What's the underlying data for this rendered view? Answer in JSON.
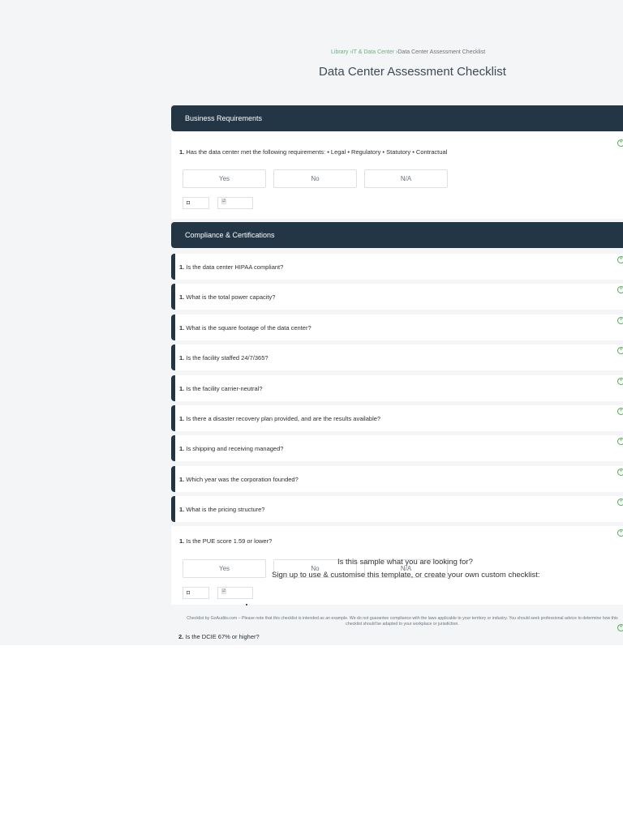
{
  "breadcrumb": {
    "library": "Library",
    "category": "›IT & Data Center",
    "current": "›Data Center Assessment Checklist"
  },
  "page_title": "Data Center Assessment Checklist",
  "sections": [
    {
      "title": "Business Requirements",
      "question": {
        "number": "1.",
        "text": "Has the data center met the following requirements: • Legal • Regulatory • Statutory • Contractual",
        "answers": [
          "Yes",
          "No",
          "N/A"
        ]
      }
    },
    {
      "title": "Compliance & Certifications",
      "questions": [
        {
          "number": "1.",
          "text": "Is the data center HIPAA compliant?"
        },
        {
          "number": "1.",
          "text": "What is the total power capacity?"
        },
        {
          "number": "1.",
          "text": "What is the square footage of the data center?"
        },
        {
          "number": "1.",
          "text": "Is the facility staffed 24/7/365?"
        },
        {
          "number": "1.",
          "text": "Is the facility carrier-neutral?"
        },
        {
          "number": "1.",
          "text": "Is there a disaster recovery plan provided, and are the results available?"
        },
        {
          "number": "1.",
          "text": "Is shipping and receiving managed?"
        },
        {
          "number": "1.",
          "text": "Which year was the corporation founded?"
        },
        {
          "number": "1.",
          "text": "What is the pricing structure?"
        }
      ],
      "open_question": {
        "number": "1.",
        "text": "Is the PUE score 1.59 or lower?",
        "answers": [
          "Yes",
          "No",
          "N/A"
        ]
      },
      "next_question": {
        "number": "2.",
        "text": "Is the DCIE 67% or higher?"
      }
    }
  ],
  "icons": {
    "add": "plus-circle-icon",
    "photo": "camera-icon",
    "note": "document-icon"
  },
  "glyphs": {
    "plus": "+",
    "camera": "◘",
    "document": "🗎"
  },
  "overlay": {
    "line1": "Is this sample what you are looking for?",
    "line2": "Sign up to use & customise this template, or create your own custom checklist:"
  },
  "disclaimer": "Checklist by GoAudits.com – Please note that this checklist is intended as an example. We do not guarantee compliance with the laws applicable to your territory or industry. You should seek professional advice to determine how this checklist should be adapted to your workplace or jurisdiction.",
  "colors": {
    "header_bg": "#233645",
    "accent_green": "#4caf50",
    "link_green": "#6fb07f",
    "page_bg": "#f3f5f7"
  }
}
